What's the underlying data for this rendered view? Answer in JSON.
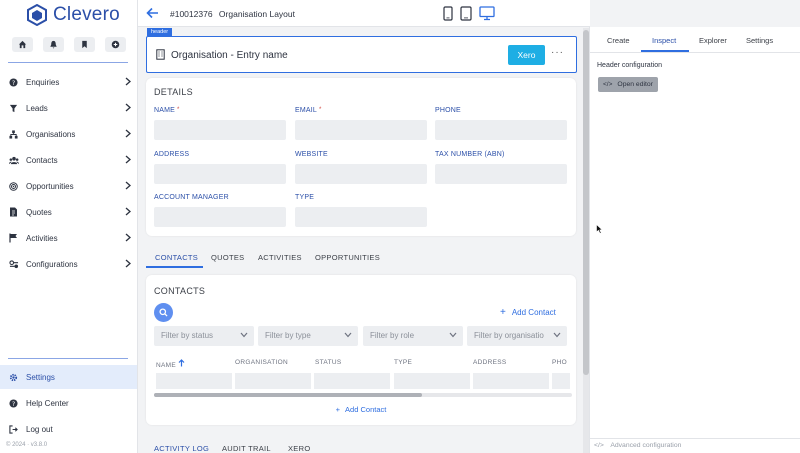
{
  "brand": {
    "name": "Clevero",
    "accent": "#2f6ee0"
  },
  "sidebar": {
    "quick_icons": [
      "home-icon",
      "bell-icon",
      "bookmark-icon",
      "plus-circle-icon"
    ],
    "items": [
      {
        "label": "Enquiries",
        "icon": "question-circle-icon"
      },
      {
        "label": "Leads",
        "icon": "funnel-icon"
      },
      {
        "label": "Organisations",
        "icon": "org-chart-icon"
      },
      {
        "label": "Contacts",
        "icon": "people-icon"
      },
      {
        "label": "Opportunities",
        "icon": "target-icon"
      },
      {
        "label": "Quotes",
        "icon": "document-dollar-icon"
      },
      {
        "label": "Activities",
        "icon": "flag-icon"
      },
      {
        "label": "Configurations",
        "icon": "config-icon"
      }
    ],
    "bottom_items": [
      {
        "label": "Settings",
        "icon": "gear-icon"
      },
      {
        "label": "Help Center",
        "icon": "help-icon"
      },
      {
        "label": "Log out",
        "icon": "logout-icon"
      }
    ],
    "version": "© 2024 · v3.8.0"
  },
  "topbar": {
    "record_number": "#10012376",
    "title": "Organisation Layout"
  },
  "header_section": {
    "tag": "header",
    "name": "Organisation - Entry name",
    "xero_label": "Xero",
    "more_label": "···"
  },
  "details": {
    "title": "DETAILS",
    "fields": [
      {
        "label": "NAME",
        "required": "*"
      },
      {
        "label": "EMAIL",
        "required": "*"
      },
      {
        "label": "PHONE",
        "required": ""
      },
      {
        "label": "ADDRESS",
        "required": ""
      },
      {
        "label": "WEBSITE",
        "required": ""
      },
      {
        "label": "TAX NUMBER (ABN)",
        "required": ""
      },
      {
        "label": "ACCOUNT MANAGER",
        "required": ""
      },
      {
        "label": "TYPE",
        "required": ""
      }
    ]
  },
  "tabs": [
    "CONTACTS",
    "QUOTES",
    "ACTIVITIES",
    "OPPORTUNITIES"
  ],
  "contacts": {
    "title": "CONTACTS",
    "add_label": "Add Contact",
    "filters": [
      "Filter by status",
      "Filter by type",
      "Filter by role",
      "Filter by organisatio"
    ],
    "columns": [
      "NAME",
      "ORGANISATION",
      "STATUS",
      "TYPE",
      "ADDRESS",
      "PHO"
    ]
  },
  "bottom_tabs": [
    "ACTIVITY LOG",
    "AUDIT TRAIL",
    "XERO"
  ],
  "panel": {
    "tabs": [
      "Create",
      "Inspect",
      "Explorer",
      "Settings"
    ],
    "heading": "Header configuration",
    "open_editor": "Open editor",
    "code_glyph": "</>",
    "advanced": "Advanced configuration"
  }
}
